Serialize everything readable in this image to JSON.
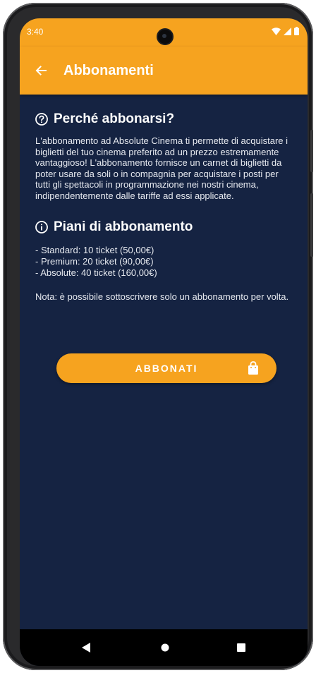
{
  "status_bar": {
    "time": "3:40",
    "icons": [
      "wifi-icon",
      "signal-icon",
      "battery-icon"
    ]
  },
  "app_bar": {
    "title": "Abbonamenti",
    "back_icon": "arrow-left-icon"
  },
  "why_section": {
    "icon": "help-circle-icon",
    "title": "Perché abbonarsi?",
    "body": "L'abbonamento ad Absolute Cinema ti permette di acquistare i biglietti del tuo cinema preferito ad un prezzo estremamente vantaggioso! L'abbonamento fornisce un carnet di biglietti da poter usare da soli o in compagnia per acquistare i posti per tutti gli spettacoli in programmazione nei nostri cinema, indipendentemente dalle tariffe ad essi applicate."
  },
  "plans_section": {
    "icon": "info-circle-icon",
    "title": "Piani di abbonamento",
    "plans": [
      "- Standard: 10 ticket (50,00€)",
      "- Premium: 20 ticket (90,00€)",
      "- Absolute: 40 ticket (160,00€)"
    ],
    "note": "Nota: è possibile sottoscrivere solo un abbonamento per volta."
  },
  "subscribe_button": {
    "label": "ABBONATI",
    "icon": "shopping-bag-icon"
  },
  "nav_bar": {
    "items": [
      "back-triangle-icon",
      "home-circle-icon",
      "recents-square-icon"
    ]
  },
  "colors": {
    "accent": "#F6A31F",
    "background": "#152342",
    "text": "#FFFFFF"
  }
}
